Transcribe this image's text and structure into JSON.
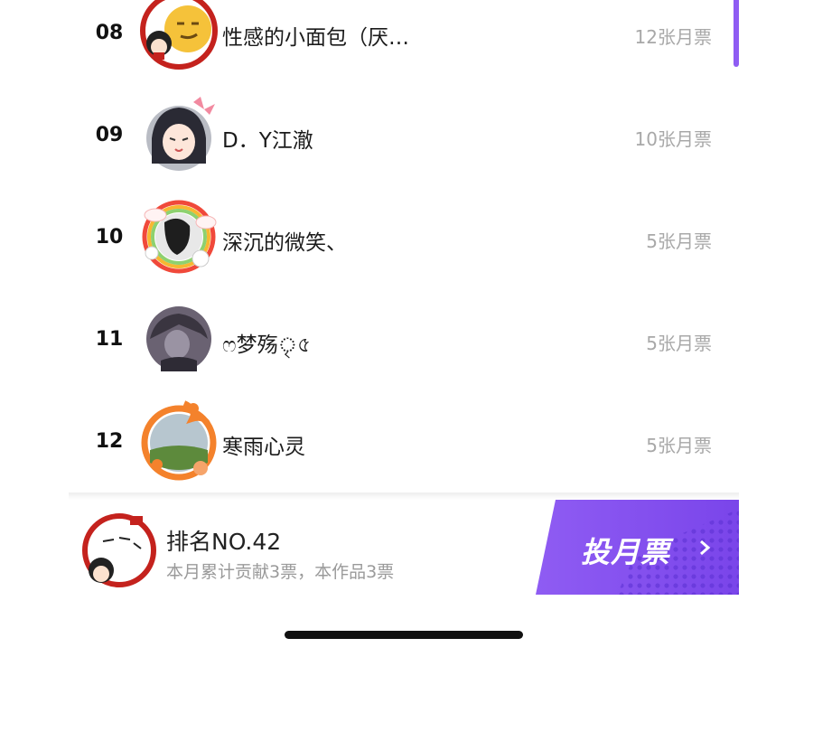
{
  "theme": {
    "accent": "#8f5cf3",
    "accent_dark": "#6d3ee0",
    "text": "#1b1b1b",
    "muted": "#a8a8a8"
  },
  "leaderboard": [
    {
      "rank": "08",
      "name": "性感的小面包（厌…",
      "tickets": "12张月票",
      "avatar_icon": "smirk-emoji-avatar-icon"
    },
    {
      "rank": "09",
      "name": "D．Y江澈",
      "tickets": "10张月票",
      "avatar_icon": "anime-girl-avatar-icon"
    },
    {
      "rank": "10",
      "name": "深沉的微笑、",
      "tickets": "5张月票",
      "avatar_icon": "rainbow-frame-avatar-icon"
    },
    {
      "rank": "11",
      "name": "ෆ梦殇ৃ৫",
      "tickets": "5张月票",
      "avatar_icon": "dark-anime-avatar-icon"
    },
    {
      "rank": "12",
      "name": "寒雨心灵",
      "tickets": "5张月票",
      "avatar_icon": "dragon-frame-avatar-icon"
    }
  ],
  "footer": {
    "rank_text": "排名NO.42",
    "contribution_text": "本月累计贡献3票，本作品3票",
    "vote_button_label": "投月票",
    "avatar_icon": "user-avatar-icon"
  }
}
